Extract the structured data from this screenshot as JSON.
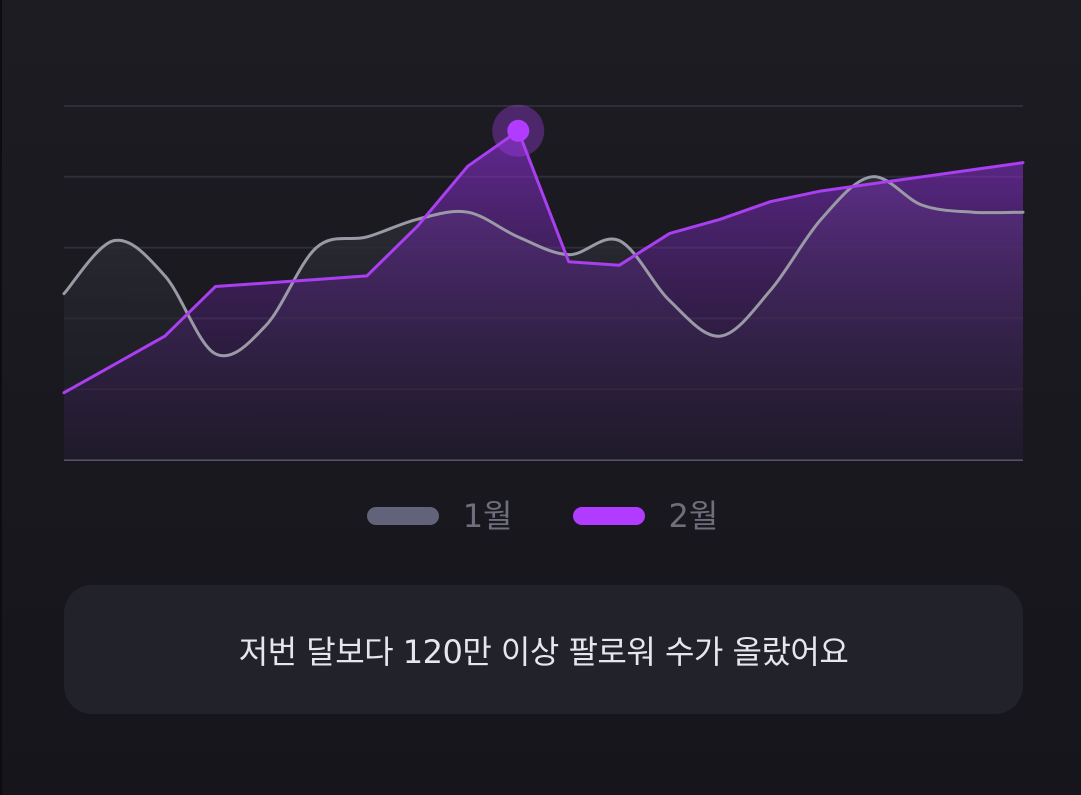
{
  "chart_data": {
    "type": "area",
    "title": "",
    "xlabel": "",
    "ylabel": "",
    "x": [
      0,
      1,
      2,
      3,
      4,
      5,
      6,
      7,
      8,
      9,
      10,
      11,
      12,
      13,
      14,
      15,
      16,
      17,
      18,
      19
    ],
    "ylim": [
      0,
      100
    ],
    "grid": true,
    "legend_position": "bottom",
    "series": [
      {
        "name": "1월",
        "color": "#9a9aa6",
        "values": [
          47,
          62,
          52,
          30,
          38,
          60,
          63,
          68,
          70,
          63,
          58,
          62,
          45,
          35,
          48,
          68,
          80,
          72,
          70,
          70
        ]
      },
      {
        "name": "2월",
        "color": "#a93ff0",
        "values": [
          19,
          27,
          35,
          49,
          50,
          51,
          52,
          66,
          83,
          93,
          56,
          55,
          64,
          68,
          73,
          76,
          78,
          80,
          82,
          84
        ]
      }
    ],
    "highlight": {
      "series": "2월",
      "index": 9
    }
  },
  "legend": {
    "items": [
      {
        "label": "1월",
        "color": "#62627a"
      },
      {
        "label": "2월",
        "color": "#b13cff"
      }
    ]
  },
  "message": {
    "text": "저번 달보다 120만 이상 팔로워 수가 올랐어요"
  },
  "colors": {
    "background": "#1a1a20",
    "card": "#22222a",
    "gridline": "#2e2e38",
    "baseline": "#55556a",
    "accent": "#b13cff"
  }
}
